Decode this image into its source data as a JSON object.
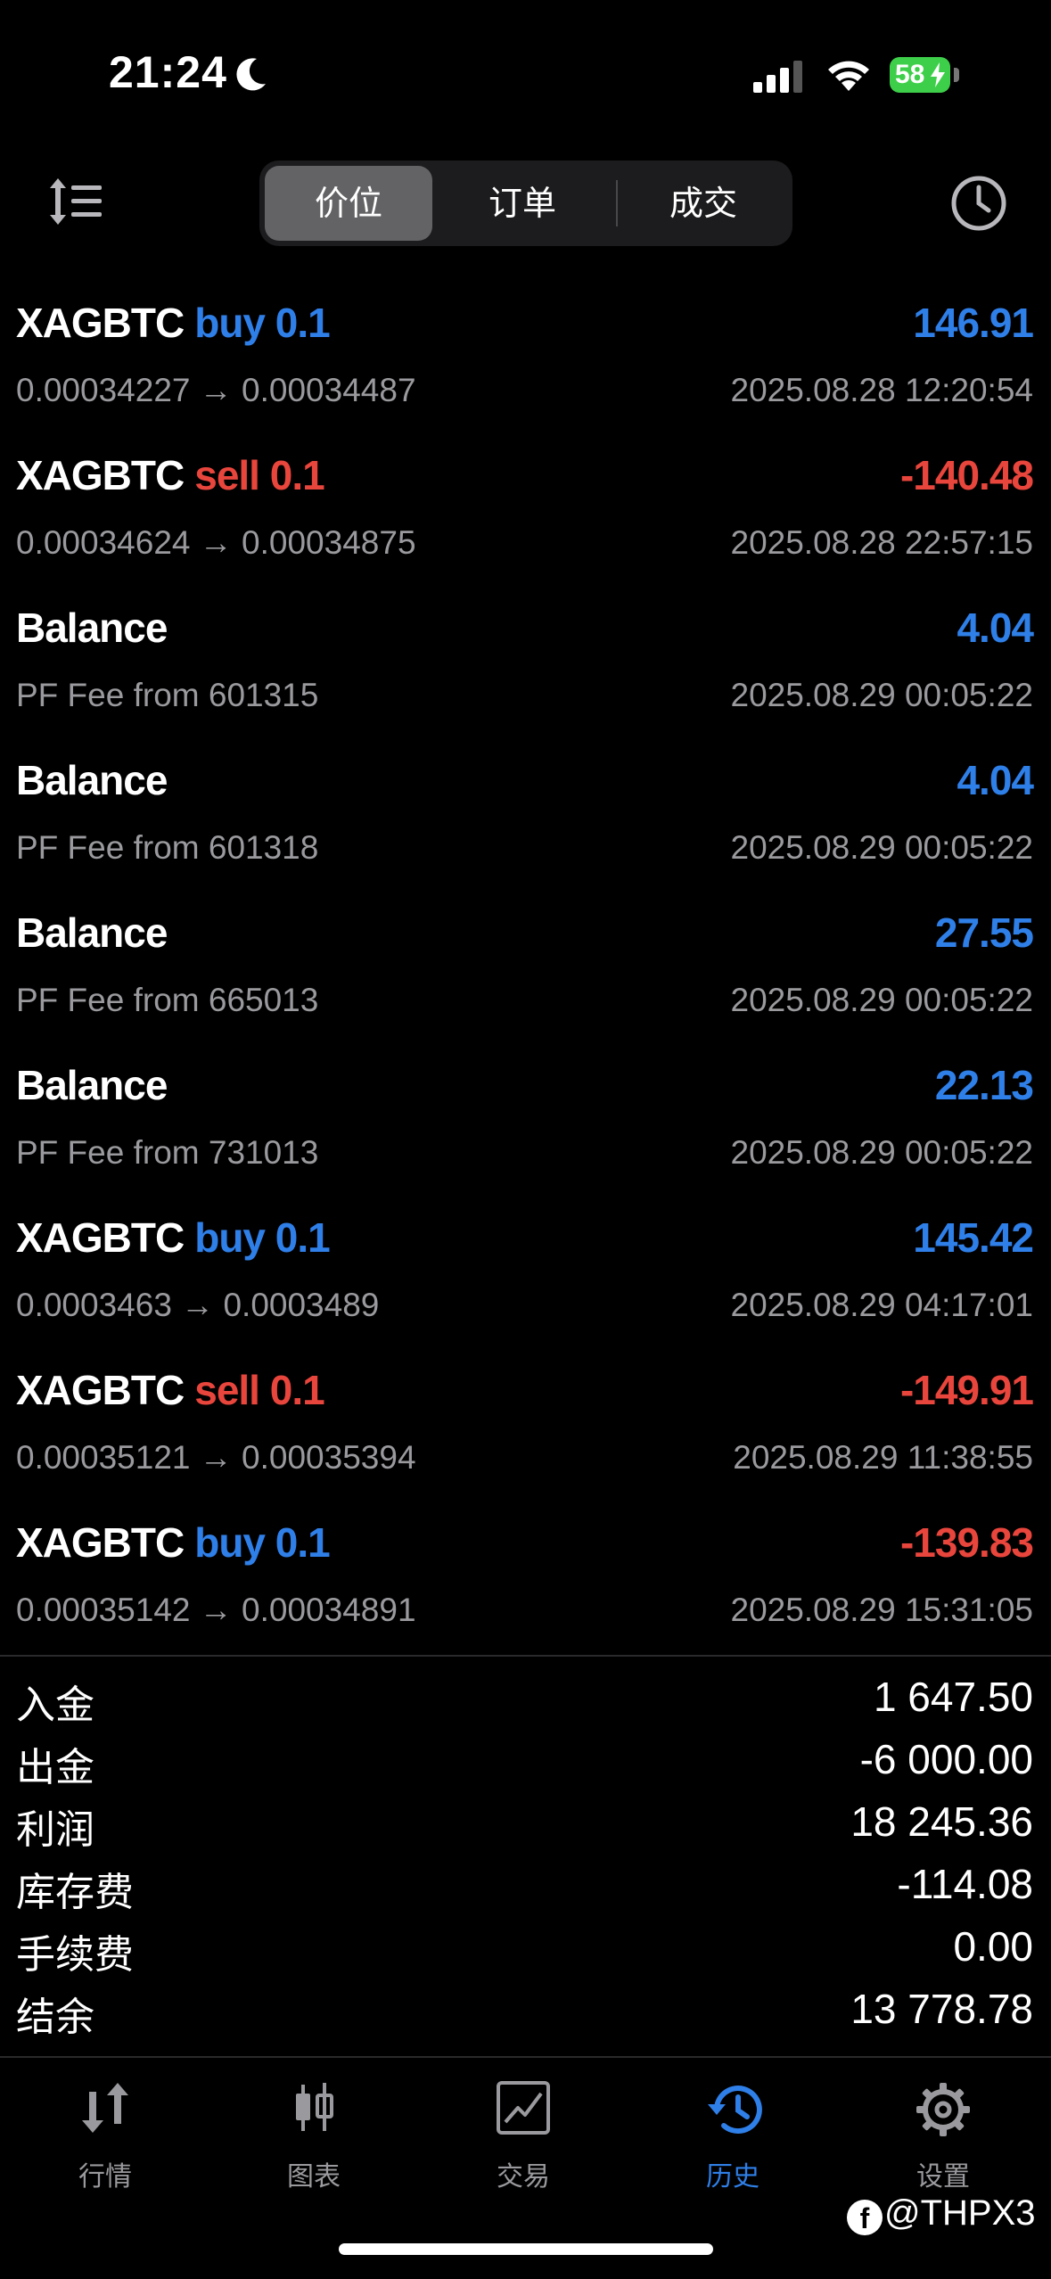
{
  "status_bar": {
    "time": "21:24",
    "battery": "58"
  },
  "header": {
    "segments": [
      {
        "label": "价位",
        "active": true
      },
      {
        "label": "订单",
        "active": false
      },
      {
        "label": "成交",
        "active": false
      }
    ]
  },
  "deals": [
    {
      "symbol": "XAGBTC",
      "side": "buy 0.1",
      "side_type": "buy",
      "detail": "0.00034227 → 0.00034487",
      "profit": "146.91",
      "profit_sign": "positive",
      "datetime": "2025.08.28 12:20:54"
    },
    {
      "symbol": "XAGBTC",
      "side": "sell 0.1",
      "side_type": "sell",
      "detail": "0.00034624 → 0.00034875",
      "profit": "-140.48",
      "profit_sign": "negative",
      "datetime": "2025.08.28 22:57:15"
    },
    {
      "symbol": "Balance",
      "side": "",
      "side_type": "",
      "detail": "PF Fee from 601315",
      "profit": "4.04",
      "profit_sign": "positive",
      "datetime": "2025.08.29 00:05:22"
    },
    {
      "symbol": "Balance",
      "side": "",
      "side_type": "",
      "detail": "PF Fee from 601318",
      "profit": "4.04",
      "profit_sign": "positive",
      "datetime": "2025.08.29 00:05:22"
    },
    {
      "symbol": "Balance",
      "side": "",
      "side_type": "",
      "detail": "PF Fee from 665013",
      "profit": "27.55",
      "profit_sign": "positive",
      "datetime": "2025.08.29 00:05:22"
    },
    {
      "symbol": "Balance",
      "side": "",
      "side_type": "",
      "detail": "PF Fee from 731013",
      "profit": "22.13",
      "profit_sign": "positive",
      "datetime": "2025.08.29 00:05:22"
    },
    {
      "symbol": "XAGBTC",
      "side": "buy 0.1",
      "side_type": "buy",
      "detail": "0.0003463 → 0.0003489",
      "profit": "145.42",
      "profit_sign": "positive",
      "datetime": "2025.08.29 04:17:01"
    },
    {
      "symbol": "XAGBTC",
      "side": "sell 0.1",
      "side_type": "sell",
      "detail": "0.00035121 → 0.00035394",
      "profit": "-149.91",
      "profit_sign": "negative",
      "datetime": "2025.08.29 11:38:55"
    },
    {
      "symbol": "XAGBTC",
      "side": "buy 0.1",
      "side_type": "buy",
      "detail": "0.00035142 → 0.00034891",
      "profit": "-139.83",
      "profit_sign": "negative",
      "datetime": "2025.08.29 15:31:05"
    }
  ],
  "summary": [
    {
      "label": "入金",
      "value": "1 647.50"
    },
    {
      "label": "出金",
      "value": "-6 000.00"
    },
    {
      "label": "利润",
      "value": "18 245.36"
    },
    {
      "label": "库存费",
      "value": "-114.08"
    },
    {
      "label": "手续费",
      "value": "0.00"
    },
    {
      "label": "结余",
      "value": "13 778.78"
    }
  ],
  "tabbar": [
    {
      "label": "行情",
      "icon": "quotes-arrows-icon",
      "active": false
    },
    {
      "label": "图表",
      "icon": "chart-candles-icon",
      "active": false
    },
    {
      "label": "交易",
      "icon": "trade-chart-icon",
      "active": false
    },
    {
      "label": "历史",
      "icon": "history-clock-icon",
      "active": true
    },
    {
      "label": "设置",
      "icon": "gear-icon",
      "active": false
    }
  ],
  "watermark": "@THPX3",
  "colors": {
    "blue": "#2f7fe8",
    "red": "#e8453c",
    "muted": "#9a9a9e",
    "battery": "#3ecf4a"
  }
}
